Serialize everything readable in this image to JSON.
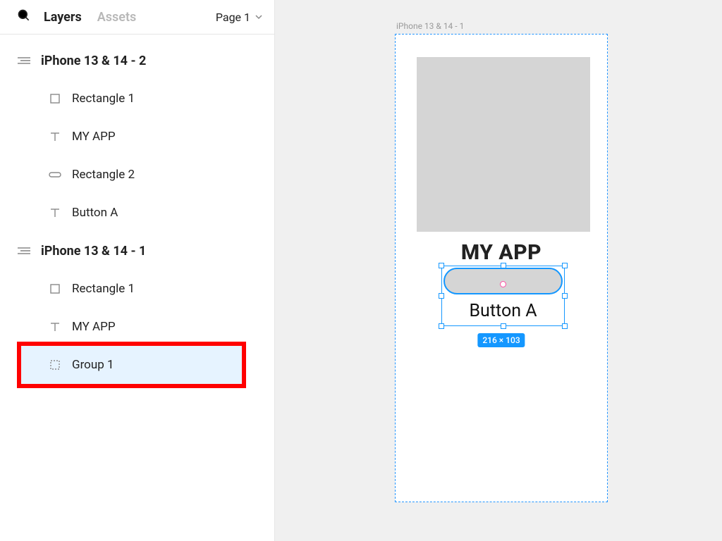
{
  "panel": {
    "tab_layers": "Layers",
    "tab_assets": "Assets",
    "page_label": "Page 1"
  },
  "tree": {
    "frame2": "iPhone 13 & 14 - 2",
    "frame2_children": {
      "rect1": "Rectangle 1",
      "txt": "MY APP",
      "rect2": "Rectangle 2",
      "btn": "Button A"
    },
    "frame1": "iPhone 13 & 14 - 1",
    "frame1_children": {
      "rect1": "Rectangle 1",
      "txt": "MY APP",
      "group": "Group 1"
    }
  },
  "canvas": {
    "frame_label": "iPhone 13 & 14 - 1",
    "app_title": "MY APP",
    "button_text": "Button A",
    "selection_size": "216 × 103"
  }
}
